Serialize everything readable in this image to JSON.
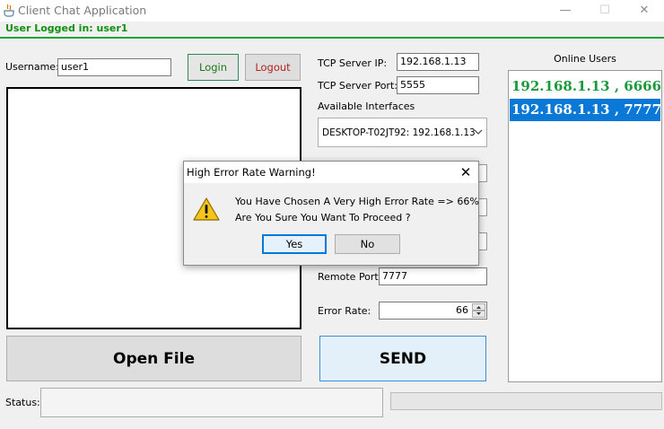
{
  "window": {
    "title": "Client Chat Application",
    "minimize_glyph": "—",
    "maximize_glyph": "☐",
    "close_glyph": "✕"
  },
  "header": {
    "user_logged": "User Logged in: user1"
  },
  "login": {
    "username_label": "Username:",
    "username_value": "user1",
    "login_label": "Login",
    "logout_label": "Logout"
  },
  "connection": {
    "tcp_ip_label": "TCP Server IP:",
    "tcp_ip_value": "192.168.1.13",
    "tcp_port_label": "TCP Server Port:",
    "tcp_port_value": "5555",
    "interfaces_label": "Available Interfaces",
    "interface_value": "DESKTOP-T02JT92: 192.168.1.13",
    "remote_port_label": "Remote Port:",
    "remote_port_value": "7777",
    "error_rate_label": "Error Rate:",
    "error_rate_value": "66"
  },
  "users": {
    "title": "Online Users",
    "items": [
      "192.168.1.13 , 6666",
      "192.168.1.13 , 7777"
    ],
    "selected_index": 1
  },
  "actions": {
    "open_file_label": "Open File",
    "send_label": "SEND"
  },
  "status": {
    "label": "Status:",
    "value": ""
  },
  "dialog": {
    "title": "High Error Rate Warning!",
    "message_line1": "You Have Chosen A Very High Error Rate => 66%",
    "message_line2": "Are You Sure You Want To Proceed ?",
    "yes_label": "Yes",
    "no_label": "No",
    "close_glyph": "✕"
  },
  "colors": {
    "logged_in_text": "#109010",
    "accent_line": "#1aa534",
    "user_online": "#1a9a3a",
    "selection": "#0a78d7",
    "logout_text": "#b22222"
  },
  "icons": [
    "java-app-icon",
    "warning-icon",
    "chevron-down-icon"
  ]
}
